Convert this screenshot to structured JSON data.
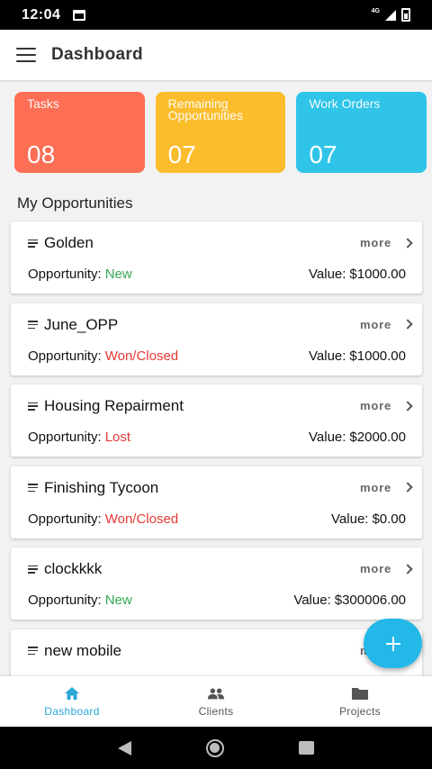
{
  "status_bar": {
    "time": "12:04",
    "network": "4G"
  },
  "app_bar": {
    "title": "Dashboard"
  },
  "stats": [
    {
      "title": "Tasks",
      "value": "08",
      "color": "#fd6f55"
    },
    {
      "title": "Remaining Opportunities",
      "value": "07",
      "color": "#fcbd2c"
    },
    {
      "title": "Work Orders",
      "value": "07",
      "color": "#2fc4e8"
    }
  ],
  "section_title": "My Opportunities",
  "more_label": "more",
  "status_prefix": "Opportunity:",
  "value_prefix": "Value:",
  "status_colors": {
    "New": "#34a853",
    "Won/Closed": "#e53935",
    "Lost": "#e53935"
  },
  "opportunities": [
    {
      "name": "Golden",
      "status": "New",
      "value": "$1000.00"
    },
    {
      "name": "June_OPP",
      "status": "Won/Closed",
      "value": "$1000.00"
    },
    {
      "name": "Housing Repairment",
      "status": "Lost",
      "value": "$2000.00"
    },
    {
      "name": "Finishing Tycoon",
      "status": "Won/Closed",
      "value": "$0.00"
    },
    {
      "name": "clockkkk",
      "status": "New",
      "value": "$300006.00"
    },
    {
      "name": "new mobile",
      "status": "",
      "value": ""
    }
  ],
  "bottom_nav": [
    {
      "label": "Dashboard",
      "icon": "home-icon",
      "active": true
    },
    {
      "label": "Clients",
      "icon": "people-icon",
      "active": false
    },
    {
      "label": "Projects",
      "icon": "folder-icon",
      "active": false
    }
  ],
  "accent_color": "#29a8d8"
}
